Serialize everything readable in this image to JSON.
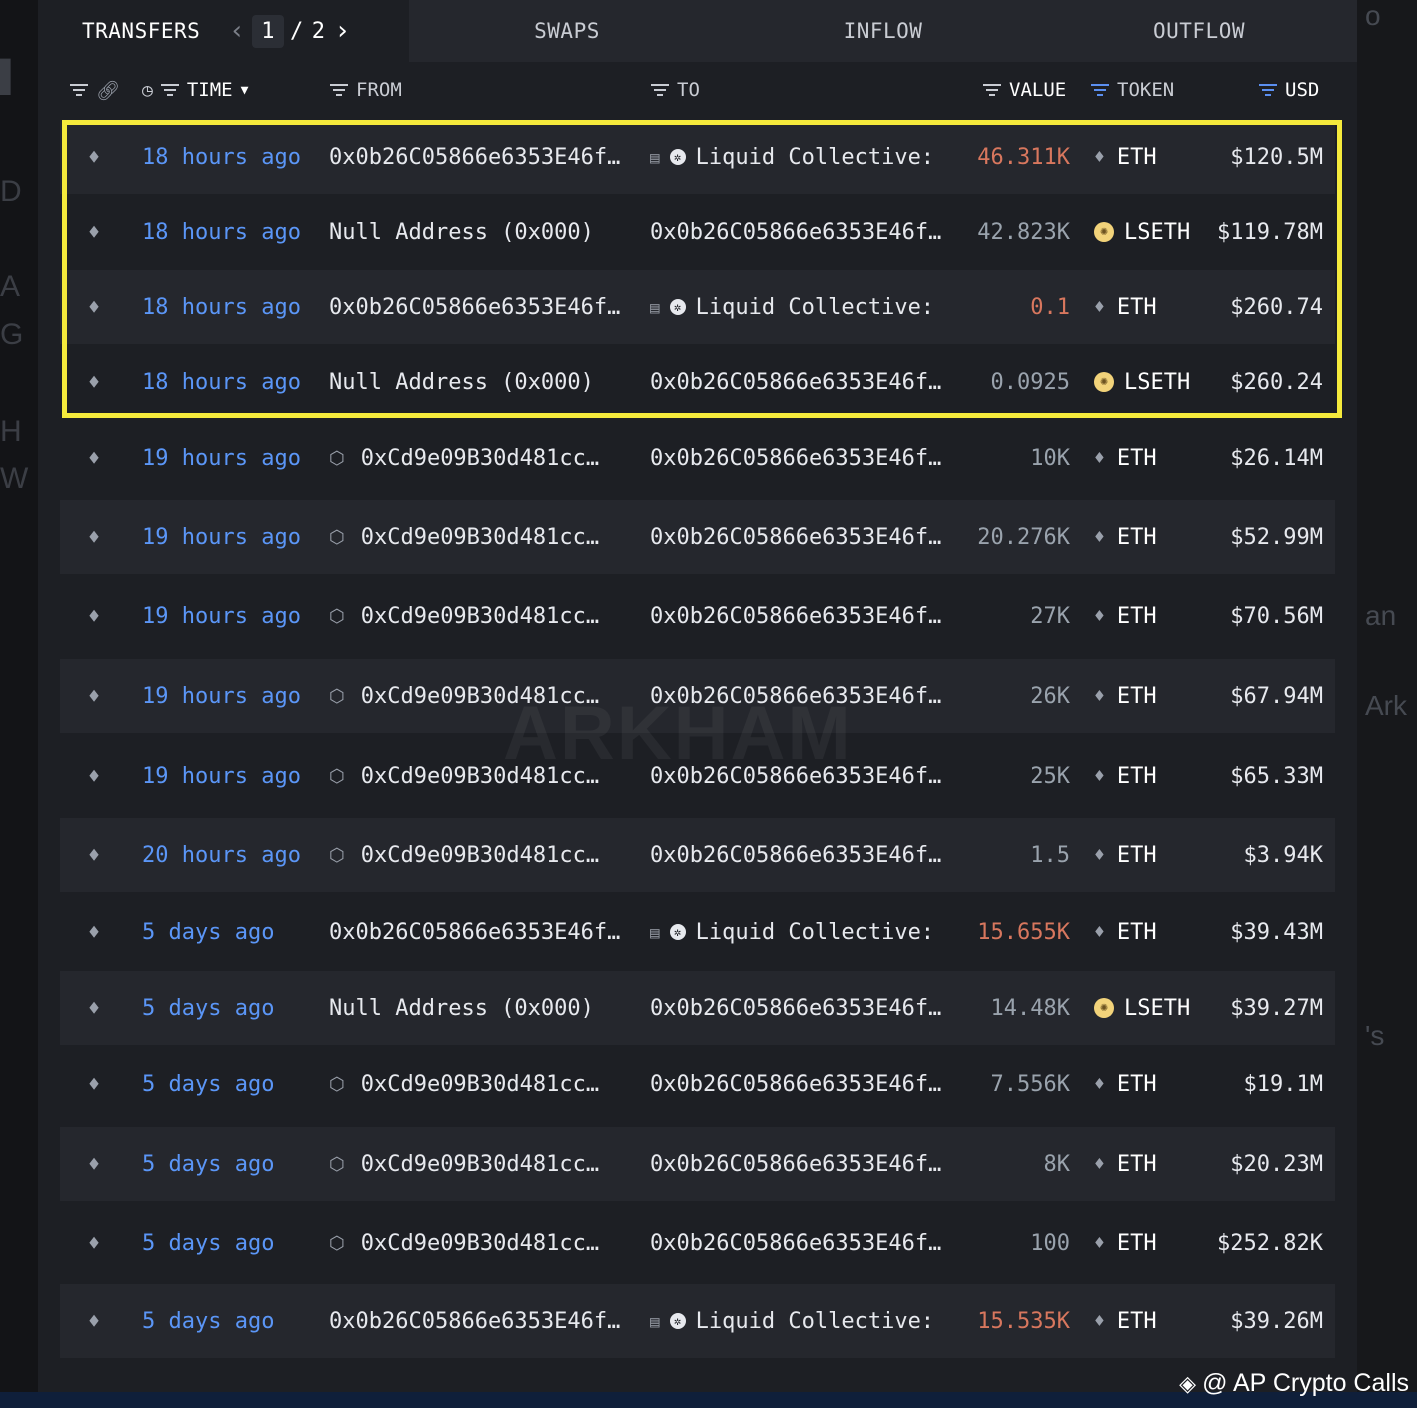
{
  "tabs": {
    "transfers": "TRANSFERS",
    "page_current": "1",
    "page_sep": "/",
    "page_total": "2",
    "swaps": "SWAPS",
    "inflow": "INFLOW",
    "outflow": "OUTFLOW"
  },
  "headers": {
    "time": "TIME",
    "from": "FROM",
    "to": "TO",
    "value": "VALUE",
    "token": "TOKEN",
    "usd": "USD"
  },
  "rows": [
    {
      "time": "18 hours ago",
      "from": "0x0b26C05866e6353E46f…",
      "to": "Liquid Collective:",
      "value": "46.311K",
      "token": "ETH",
      "usd": "$120.5M"
    },
    {
      "time": "18 hours ago",
      "from": "Null Address (0x000)",
      "to": "0x0b26C05866e6353E46f…",
      "value": "42.823K",
      "token": "LSETH",
      "usd": "$119.78M"
    },
    {
      "time": "18 hours ago",
      "from": "0x0b26C05866e6353E46f…",
      "to": "Liquid Collective:",
      "value": "0.1",
      "token": "ETH",
      "usd": "$260.74"
    },
    {
      "time": "18 hours ago",
      "from": "Null Address (0x000)",
      "to": "0x0b26C05866e6353E46f…",
      "value": "0.0925",
      "token": "LSETH",
      "usd": "$260.24"
    },
    {
      "time": "19 hours ago",
      "from": "0xCd9e09B30d481cc…",
      "to": "0x0b26C05866e6353E46f…",
      "value": "10K",
      "token": "ETH",
      "usd": "$26.14M"
    },
    {
      "time": "19 hours ago",
      "from": "0xCd9e09B30d481cc…",
      "to": "0x0b26C05866e6353E46f…",
      "value": "20.276K",
      "token": "ETH",
      "usd": "$52.99M"
    },
    {
      "time": "19 hours ago",
      "from": "0xCd9e09B30d481cc…",
      "to": "0x0b26C05866e6353E46f…",
      "value": "27K",
      "token": "ETH",
      "usd": "$70.56M"
    },
    {
      "time": "19 hours ago",
      "from": "0xCd9e09B30d481cc…",
      "to": "0x0b26C05866e6353E46f…",
      "value": "26K",
      "token": "ETH",
      "usd": "$67.94M"
    },
    {
      "time": "19 hours ago",
      "from": "0xCd9e09B30d481cc…",
      "to": "0x0b26C05866e6353E46f…",
      "value": "25K",
      "token": "ETH",
      "usd": "$65.33M"
    },
    {
      "time": "20 hours ago",
      "from": "0xCd9e09B30d481cc…",
      "to": "0x0b26C05866e6353E46f…",
      "value": "1.5",
      "token": "ETH",
      "usd": "$3.94K"
    },
    {
      "time": "5 days ago",
      "from": "0x0b26C05866e6353E46f…",
      "to": "Liquid Collective:",
      "value": "15.655K",
      "token": "ETH",
      "usd": "$39.43M"
    },
    {
      "time": "5 days ago",
      "from": "Null Address (0x000)",
      "to": "0x0b26C05866e6353E46f…",
      "value": "14.48K",
      "token": "LSETH",
      "usd": "$39.27M"
    },
    {
      "time": "5 days ago",
      "from": "0xCd9e09B30d481cc…",
      "to": "0x0b26C05866e6353E46f…",
      "value": "7.556K",
      "token": "ETH",
      "usd": "$19.1M"
    },
    {
      "time": "5 days ago",
      "from": "0xCd9e09B30d481cc…",
      "to": "0x0b26C05866e6353E46f…",
      "value": "8K",
      "token": "ETH",
      "usd": "$20.23M"
    },
    {
      "time": "5 days ago",
      "from": "0xCd9e09B30d481cc…",
      "to": "0x0b26C05866e6353E46f…",
      "value": "100",
      "token": "ETH",
      "usd": "$252.82K"
    },
    {
      "time": "5 days ago",
      "from": "0x0b26C05866e6353E46f…",
      "to": "Liquid Collective:",
      "value": "15.535K",
      "token": "ETH",
      "usd": "$39.26M"
    }
  ],
  "watermark": "ARKHAM",
  "credit": "@ AP Crypto Calls",
  "colors": {
    "highlight": "#f5ea3c",
    "time_link": "#5b96f7",
    "outflow_value": "#d8775e",
    "panel_bg": "#1d1f24"
  }
}
